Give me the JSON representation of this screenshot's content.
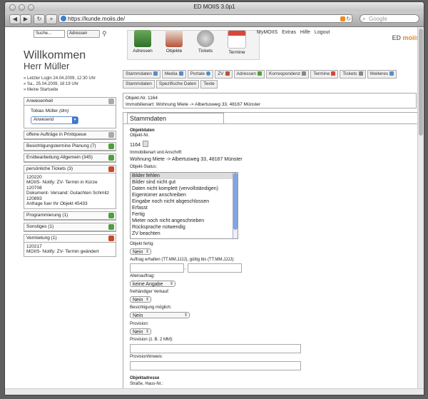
{
  "browser": {
    "title": "ED MOIIS 3.0p1",
    "url": "https://kunde.moiis.de/",
    "search_placeholder": "Google"
  },
  "quick_search": {
    "input_value": "Suche...",
    "select_value": "Adressen"
  },
  "welcome": {
    "title": "Willkommen",
    "name": "Herr Müller",
    "last_login": "» Letzter Login 24.04.2009, 12:30 Uhr",
    "now": "» Sa., 25.04.2009, 16:19 Uhr",
    "start_page": "» Meine Startseite"
  },
  "boxes": {
    "anwesenheit": {
      "title": "Anwesenheit",
      "user": "Tobias Müller",
      "user_tag": "(dm)",
      "status": "Anwesend"
    },
    "printqueue": {
      "title": "offene Aufträge in Printqueue"
    },
    "besichtigung": {
      "title": "Besichtigungstermine Planung (7)"
    },
    "erstbearbeitung": {
      "title": "Erstbearbeitung Allgemein (345)"
    },
    "tickets": {
      "title": "persönliche Tickets (3)",
      "items": [
        {
          "id": "120220",
          "text": "MOIIS- Notify: ZV- Termin in Kürze"
        },
        {
          "id": "120708",
          "text": "Dokument- Versand: Gutachten Schmitz"
        },
        {
          "id": "120893",
          "text": "Anfrage fuer Ihr Objekt 45433"
        }
      ]
    },
    "programmierung": {
      "title": "Programmierung (1)"
    },
    "sonstiges": {
      "title": "Sonstiges (1)"
    },
    "vermietung": {
      "title": "Vermietung (1)",
      "item_id": "120217",
      "item_text": "MOIIS- Notify: ZV- Termin geändert"
    }
  },
  "main_nav": {
    "adressen": "Adressen",
    "objekte": "Objekte",
    "tickets": "Tickets",
    "termine": "Termine"
  },
  "top_links": {
    "mymoiis": "MyMOIIS",
    "extras": "Extras",
    "hilfe": "Hilfe",
    "logout": "Logout"
  },
  "brand": {
    "ed": "ED",
    "name": "moiis"
  },
  "tabs": {
    "row1": [
      "Stammdaten",
      "Media",
      "Portale",
      "ZV",
      "Adressen",
      "Korrespondenz",
      "Termine",
      "Tickets",
      "Weiteres"
    ],
    "row2": [
      "Stammdaten",
      "Spezifische Daten",
      "Texte"
    ]
  },
  "object_info": {
    "nr": "Objekt-Nr. 1164",
    "art": "Immobilienart: Wohnung Miete -> Albertusweg 33, 48167 Münster"
  },
  "form": {
    "tab_title": "Stammdaten",
    "section_title": "Objektdaten",
    "objnr_label": "Objekt-Nr.",
    "objnr_value": "1164",
    "art_label": "Immobilienart und Anschrift",
    "art_value": "Wohnung Miete -> Albertusweg 33, 48167 Münster",
    "status_label": "Objekt-Status:",
    "status_options": [
      "Bilder fehlen",
      "Bilder sind nicht gut",
      "Daten nicht komplett (vervollständigen)",
      "Eigentümer anschreiben",
      "Eingabe noch nicht abgeschlossen",
      "Erfasst",
      "Fertig",
      "Mieter noch nicht angeschrieben",
      "Rücksprache notwendig",
      "ZV beachten"
    ],
    "fertig_label": "Objekt fertig:",
    "fertig_value": "Nein",
    "auftrag_label": "Auftrag erhalten (TT.MM.JJJJ), gültig bis (TT.MM.JJJJ):",
    "auftrag_sep": ",",
    "allein_label": "Alleinauftrag:",
    "allein_value": "keine Angabe",
    "freihand_label": "freihändiger Verkauf:",
    "freihand_value": "Nein",
    "besicht_label": "Besichtigung möglich:",
    "besicht_value": "Nein",
    "provision_label": "Provision:",
    "provision_value": "Nein",
    "provision2_label": "Provision (z. B. 2 MM):",
    "provhinweis_label": "Provisionhinweis:",
    "adresse_title": "Objektadresse",
    "strasse_label": "Straße, Haus-Nr.:"
  },
  "colors": {
    "accent_blue": "#3d77d0",
    "brand_orange": "#e8872a",
    "green_icon": "#4fa03c",
    "red_icon": "#c84a2d"
  }
}
